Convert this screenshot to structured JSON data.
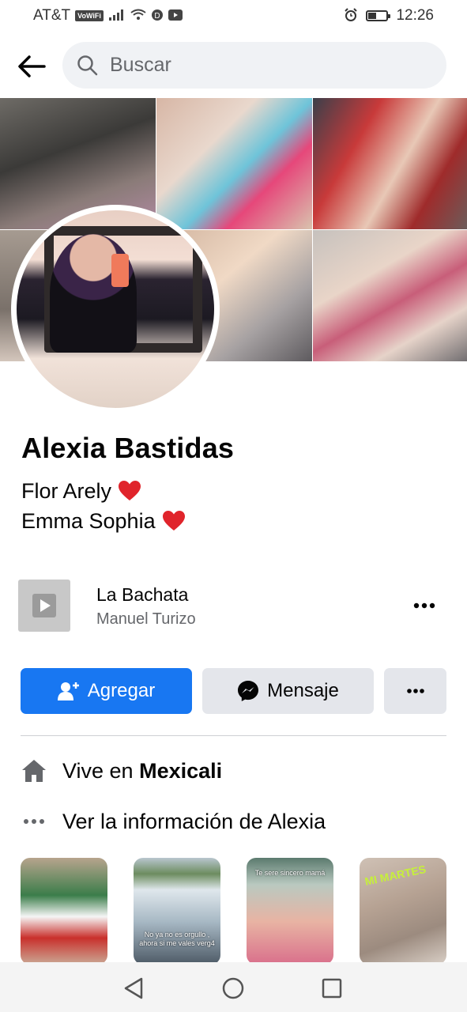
{
  "status_bar": {
    "carrier": "AT&T",
    "vowifi": "VoWiFi",
    "time": "12:26"
  },
  "search": {
    "placeholder": "Buscar"
  },
  "profile": {
    "name": "Alexia Bastidas",
    "bio_lines": [
      "Flor Arely",
      "Emma Sophia"
    ]
  },
  "music": {
    "title": "La Bachata",
    "artist": "Manuel Turizo"
  },
  "actions": {
    "add_label": "Agregar",
    "message_label": "Mensaje"
  },
  "info": {
    "lives_prefix": "Vive en",
    "lives_city": "Mexicali",
    "see_more": "Ver la información de Alexia"
  },
  "stories": [
    {
      "caption": ""
    },
    {
      "caption": "No ya no es orgullo , ahora si me vales verg4"
    },
    {
      "caption": "Te sere sincero mamá"
    },
    {
      "caption": "MI MARTES"
    }
  ],
  "colors": {
    "primary_blue": "#1877f2",
    "secondary_gray": "#e4e6eb",
    "heart_red": "#e0242b"
  }
}
